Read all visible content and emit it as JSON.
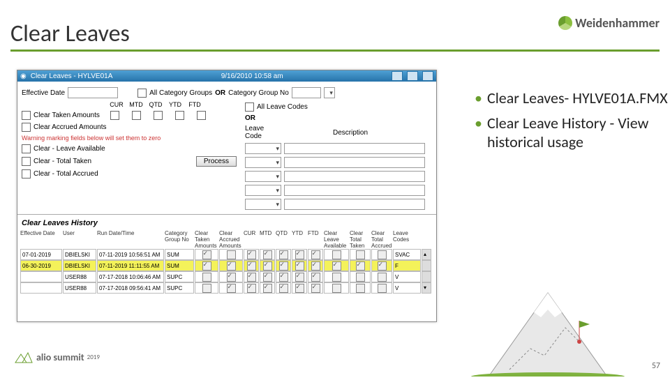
{
  "slide": {
    "title": "Clear Leaves",
    "brand": "Weidenhammer",
    "page_number": "57",
    "footer_logo": "alio summit",
    "footer_year": "2019"
  },
  "bullets": [
    "Clear Leaves- HYLVE01A.FMX",
    "Clear Leave History - View historical usage"
  ],
  "app": {
    "title": "Clear Leaves - HYLVE01A",
    "timestamp": "9/16/2010  10:58 am",
    "effective_date_label": "Effective Date",
    "all_category_groups": "All Category Groups",
    "or": "OR",
    "category_group_no": "Category Group No",
    "col_labels": [
      "CUR",
      "MTD",
      "QTD",
      "YTD",
      "FTD"
    ],
    "clear_taken": "Clear Taken Amounts",
    "clear_accrued": "Clear Accrued Amounts",
    "all_leave_codes": "All Leave Codes",
    "leave_code": "Leave Code",
    "description": "Description",
    "warning": "Warning marking fields below will set them to zero",
    "warn_items": [
      "Clear - Leave Available",
      "Clear - Total Taken",
      "Clear - Total Accrued"
    ],
    "process": "Process",
    "history_title": "Clear Leaves History",
    "history_headers": [
      "Effective Date",
      "User",
      "Run Date/Time",
      "Category Group No",
      "Clear Taken Amounts",
      "Clear Accrued Amounts",
      "CUR",
      "MTD",
      "QTD",
      "YTD",
      "FTD",
      "Clear Leave Available",
      "Clear Total Taken",
      "Clear Total Accrued",
      "Leave Codes",
      ""
    ],
    "history_rows": [
      {
        "eff": "07-01-2019",
        "user": "DBIELSKI",
        "run": "07-11-2019 10:56:51 AM",
        "grp": "SUM",
        "ct": true,
        "ca": false,
        "c": [
          true,
          true,
          true,
          true,
          true
        ],
        "av": false,
        "tt": false,
        "ta": false,
        "codes": "SVAC",
        "scroll": "▴",
        "hl": false
      },
      {
        "eff": "06-30-2019",
        "user": "DBIELSKI",
        "run": "07-11-2019 11:11:55 AM",
        "grp": "SUM",
        "ct": true,
        "ca": true,
        "c": [
          true,
          true,
          true,
          true,
          true
        ],
        "av": true,
        "tt": true,
        "ta": true,
        "codes": "F",
        "scroll": "",
        "hl": true
      },
      {
        "eff": "",
        "user": "USER88",
        "run": "07-17-2018 10:06:46 AM",
        "grp": "SUPC",
        "ct": false,
        "ca": true,
        "c": [
          true,
          true,
          true,
          true,
          true
        ],
        "av": false,
        "tt": false,
        "ta": false,
        "codes": "V",
        "scroll": "",
        "hl": false
      },
      {
        "eff": "",
        "user": "USER88",
        "run": "07-17-2018 09:56:41 AM",
        "grp": "SUPC",
        "ct": false,
        "ca": true,
        "c": [
          true,
          true,
          true,
          true,
          true
        ],
        "av": false,
        "tt": false,
        "ta": false,
        "codes": "V",
        "scroll": "▾",
        "hl": false
      }
    ]
  }
}
